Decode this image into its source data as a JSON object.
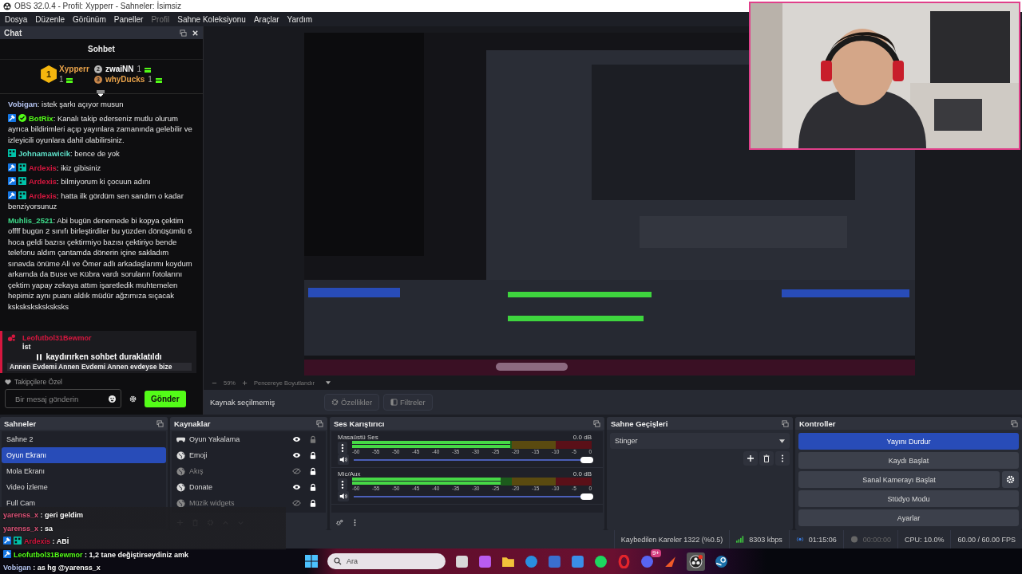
{
  "window": {
    "title": "OBS 32.0.4 - Profil: Xypperr - Sahneler: İsimsiz"
  },
  "menu": [
    {
      "label": "Dosya",
      "disabled": false
    },
    {
      "label": "Düzenle",
      "disabled": false
    },
    {
      "label": "Görünüm",
      "disabled": false
    },
    {
      "label": "Paneller",
      "disabled": false
    },
    {
      "label": "Profil",
      "disabled": true
    },
    {
      "label": "Sahne Koleksiyonu",
      "disabled": false
    },
    {
      "label": "Araçlar",
      "disabled": false
    },
    {
      "label": "Yardım",
      "disabled": false
    }
  ],
  "chat_dock": {
    "title": "Chat",
    "heading": "Sohbet",
    "leaderboard": [
      {
        "rank": "1",
        "user": "Xypperr",
        "count": "1",
        "color": "#e8a24a"
      },
      {
        "rank": "2",
        "user": "zwaiNN",
        "count": "1",
        "color": "#ffffff"
      },
      {
        "rank": "3",
        "user": "whyDucks",
        "count": "1",
        "color": "#e8a24a"
      }
    ],
    "messages": [
      {
        "user": "Vobigan",
        "color": "#b4c3f0",
        "mod": false,
        "verified": false,
        "og": false,
        "text": ": istek şarkı açıyor musun"
      },
      {
        "user": "BotRix",
        "color": "#53fc18",
        "mod": true,
        "verified": true,
        "og": false,
        "text": ": Kanalı takip ederseniz mutlu olurum ayrıca bildirimleri açıp yayınlara zamanında gelebilir ve izleyicili oyunlara dahil olabilirsiniz."
      },
      {
        "user": "Johnamawicik",
        "color": "#5ee0c8",
        "mod": false,
        "verified": false,
        "og": true,
        "text": ": bence de yok"
      },
      {
        "user": "Ardexis",
        "color": "#d6173f",
        "mod": true,
        "verified": false,
        "og": true,
        "text": ": ikiz gibisiniz"
      },
      {
        "user": "Ardexis",
        "color": "#d6173f",
        "mod": true,
        "verified": false,
        "og": true,
        "text": ": bilmiyorum ki çocuun adını"
      },
      {
        "user": "Ardexis",
        "color": "#d6173f",
        "mod": true,
        "verified": false,
        "og": true,
        "text": ": hatta ilk gördüm sen sandım o kadar benziyorsunuz"
      },
      {
        "user": "Muhlis_2521",
        "color": "#3edc8a",
        "mod": false,
        "verified": false,
        "og": false,
        "text": ": Abi bugün denemede bi kopya çektim offff bugün 2 sınıfı birleştirdiler bu yüzden dönüşümlü 6 hoca geldi bazısı çektirmiyo bazısı çektiriyo bende telefonu aldım çantamda dönerin içine sakladım sınavda önüme Ali ve Ömer adlı arkadaşlarımı koydum arkamda da Buse ve Kübra vardı soruların fotolarını çektim yapay zekaya attım işaretledik muhtemelen hepimiz aynı puanı aldık müdür ağzımıza sıçacak ksksksksksksksks"
      }
    ],
    "pinned": {
      "user": "Leofutbol31Bewmor",
      "color": "#d6173f",
      "first_line": "İst",
      "last_line": "Annen Evdemi Annen Evdemi Annen evdeyse bize"
    },
    "paused_notice": "kaydırırken sohbet duraklatıldı",
    "followers_only": "Takipçilere Özel",
    "input": {
      "placeholder": "Bir mesaj gönderin"
    },
    "send_button": "Gönder"
  },
  "preview": {
    "kind": "picture",
    "zoom": "59%",
    "fit_mode": "Pencereye Boyutlandır"
  },
  "source_toolbar": {
    "status": "Kaynak seçilmemiş",
    "buttons": [
      "Özellikler",
      "Filtreler"
    ]
  },
  "scenes": {
    "title": "Sahneler",
    "items": [
      {
        "name": "Sahne 2",
        "selected": false
      },
      {
        "name": "Oyun Ekranı",
        "selected": true
      },
      {
        "name": "Mola Ekranı",
        "selected": false
      },
      {
        "name": "Video İzleme",
        "selected": false
      },
      {
        "name": "Full Cam",
        "selected": false
      }
    ]
  },
  "sources": {
    "title": "Kaynaklar",
    "items": [
      {
        "name": "Oyun Yakalama",
        "kind": "game",
        "visible": true,
        "locked": false
      },
      {
        "name": "Emoji",
        "kind": "browser",
        "visible": true,
        "locked": true
      },
      {
        "name": "Akış",
        "kind": "browser",
        "visible": false,
        "locked": true
      },
      {
        "name": "Donate",
        "kind": "browser",
        "visible": true,
        "locked": true
      },
      {
        "name": "Müzik widgets",
        "kind": "browser",
        "visible": false,
        "locked": true
      }
    ]
  },
  "mixer": {
    "title": "Ses Karıştırıcı",
    "channels": [
      {
        "name": "Masaüstü Ses",
        "reading": "0.0 dB",
        "meter": {
          "level": 0.66
        },
        "fader": {
          "level": 1
        },
        "ticks": [
          "-60",
          "-55",
          "-50",
          "-45",
          "-40",
          "-35",
          "-30",
          "-25",
          "-20",
          "-15",
          "-10",
          "-5",
          "0"
        ]
      },
      {
        "name": "Mic/Aux",
        "reading": "0.0 dB",
        "meter": {
          "level": 0.62
        },
        "fader": {
          "level": 1
        },
        "ticks": [
          "-60",
          "-55",
          "-50",
          "-45",
          "-40",
          "-35",
          "-30",
          "-25",
          "-20",
          "-15",
          "-10",
          "-5",
          "0"
        ]
      }
    ]
  },
  "transitions": {
    "title": "Sahne Geçişleri",
    "selected": "Stinger"
  },
  "controls": {
    "title": "Kontroller",
    "buttons": [
      {
        "label": "Yayını Durdur",
        "active": true,
        "has_settings": false
      },
      {
        "label": "Kaydı Başlat",
        "active": false,
        "has_settings": false
      },
      {
        "label": "Sanal Kamerayı Başlat",
        "active": false,
        "has_settings": true
      },
      {
        "label": "Stüdyo Modu",
        "active": false,
        "has_settings": false
      },
      {
        "label": "Ayarlar",
        "active": false,
        "has_settings": false
      }
    ]
  },
  "status_bar": {
    "dropped_frames": "Kaybedilen Kareler 1322 (%0.5)",
    "bitrate": "8303 kbps",
    "stream_time": "01:15:06",
    "record_time": "00:00:00",
    "recording": false,
    "cpu": "CPU: 10.0%",
    "fps": "60.00 / 60.00 FPS"
  },
  "taskbar": {
    "search": {
      "placeholder": "Ara"
    },
    "notification_badge": "9+"
  },
  "chat_overlay": [
    {
      "user": "yarenss_x",
      "color": "#e0557a",
      "mod": false,
      "og": false,
      "text": ": geri geldim"
    },
    {
      "user": "yarenss_x",
      "color": "#e0557a",
      "mod": false,
      "og": false,
      "text": ": sa"
    },
    {
      "user": "Ardexis",
      "color": "#d6173f",
      "mod": true,
      "og": true,
      "text": ": ABİ"
    },
    {
      "user": "Leofutbol31Bewmor",
      "color": "#53fc18",
      "mod": true,
      "og": false,
      "text": ": 1,2 tane değiştirseydiniz amk"
    },
    {
      "user": "Vobigan",
      "color": "#b4c3f0",
      "mod": false,
      "og": false,
      "text": ": as hg @yarenss_x"
    }
  ]
}
